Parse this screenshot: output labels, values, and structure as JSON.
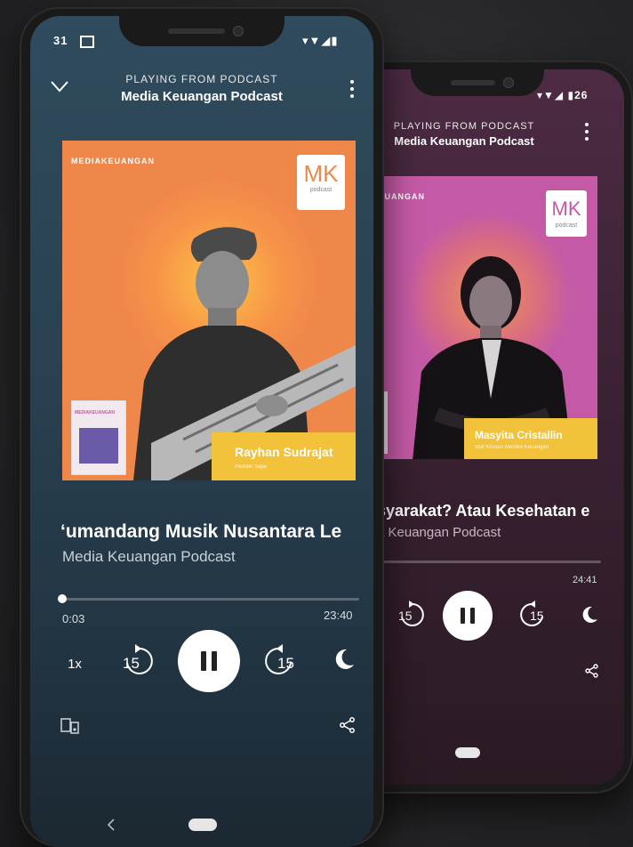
{
  "back_phone": {
    "status_right": "▾▼◢ ▮26",
    "header_sub": "PLAYING FROM PODCAST",
    "header_title": "Media Keuangan Podcast",
    "brand": "KEUANGAN",
    "mk_logo": "MK",
    "mk_sub": "podcast",
    "guest_name": "Masyita Cristallin",
    "guest_role": "Staf Khusus Menteri Keuangan",
    "episode_title": "syarakat? Atau Kesehatan e",
    "show_name": "a Keuangan Podcast",
    "duration": "24:41",
    "skip_back": "15",
    "skip_fwd": "15",
    "colors": {
      "bg_top": "#4a2a40",
      "bg_bottom": "#2a1b26",
      "art": "#c45aa6"
    }
  },
  "front_phone": {
    "status_left": "31",
    "status_right": "▾▼◢▮",
    "header_sub": "PLAYING FROM PODCAST",
    "header_title": "Media Keuangan Podcast",
    "brand": "MEDIAKEUANGAN",
    "mk_logo": "MK",
    "mk_sub": "podcast",
    "guest_name": "Rayhan Sudrajat",
    "guest_role": "Pemain Sape",
    "mag_title": "MEDIAKEUANGAN",
    "episode_title": "‘umandang Musik Nusantara Le",
    "show_name": "Media Keuangan Podcast",
    "elapsed": "0:03",
    "duration": "23:40",
    "progress_fraction": 0.002,
    "speed": "1x",
    "skip_back": "15",
    "skip_fwd": "15",
    "colors": {
      "bg_top": "#2f4a5c",
      "bg_bottom": "#1b2833",
      "art": "#f0874a",
      "namebar": "#f2c23a"
    }
  }
}
